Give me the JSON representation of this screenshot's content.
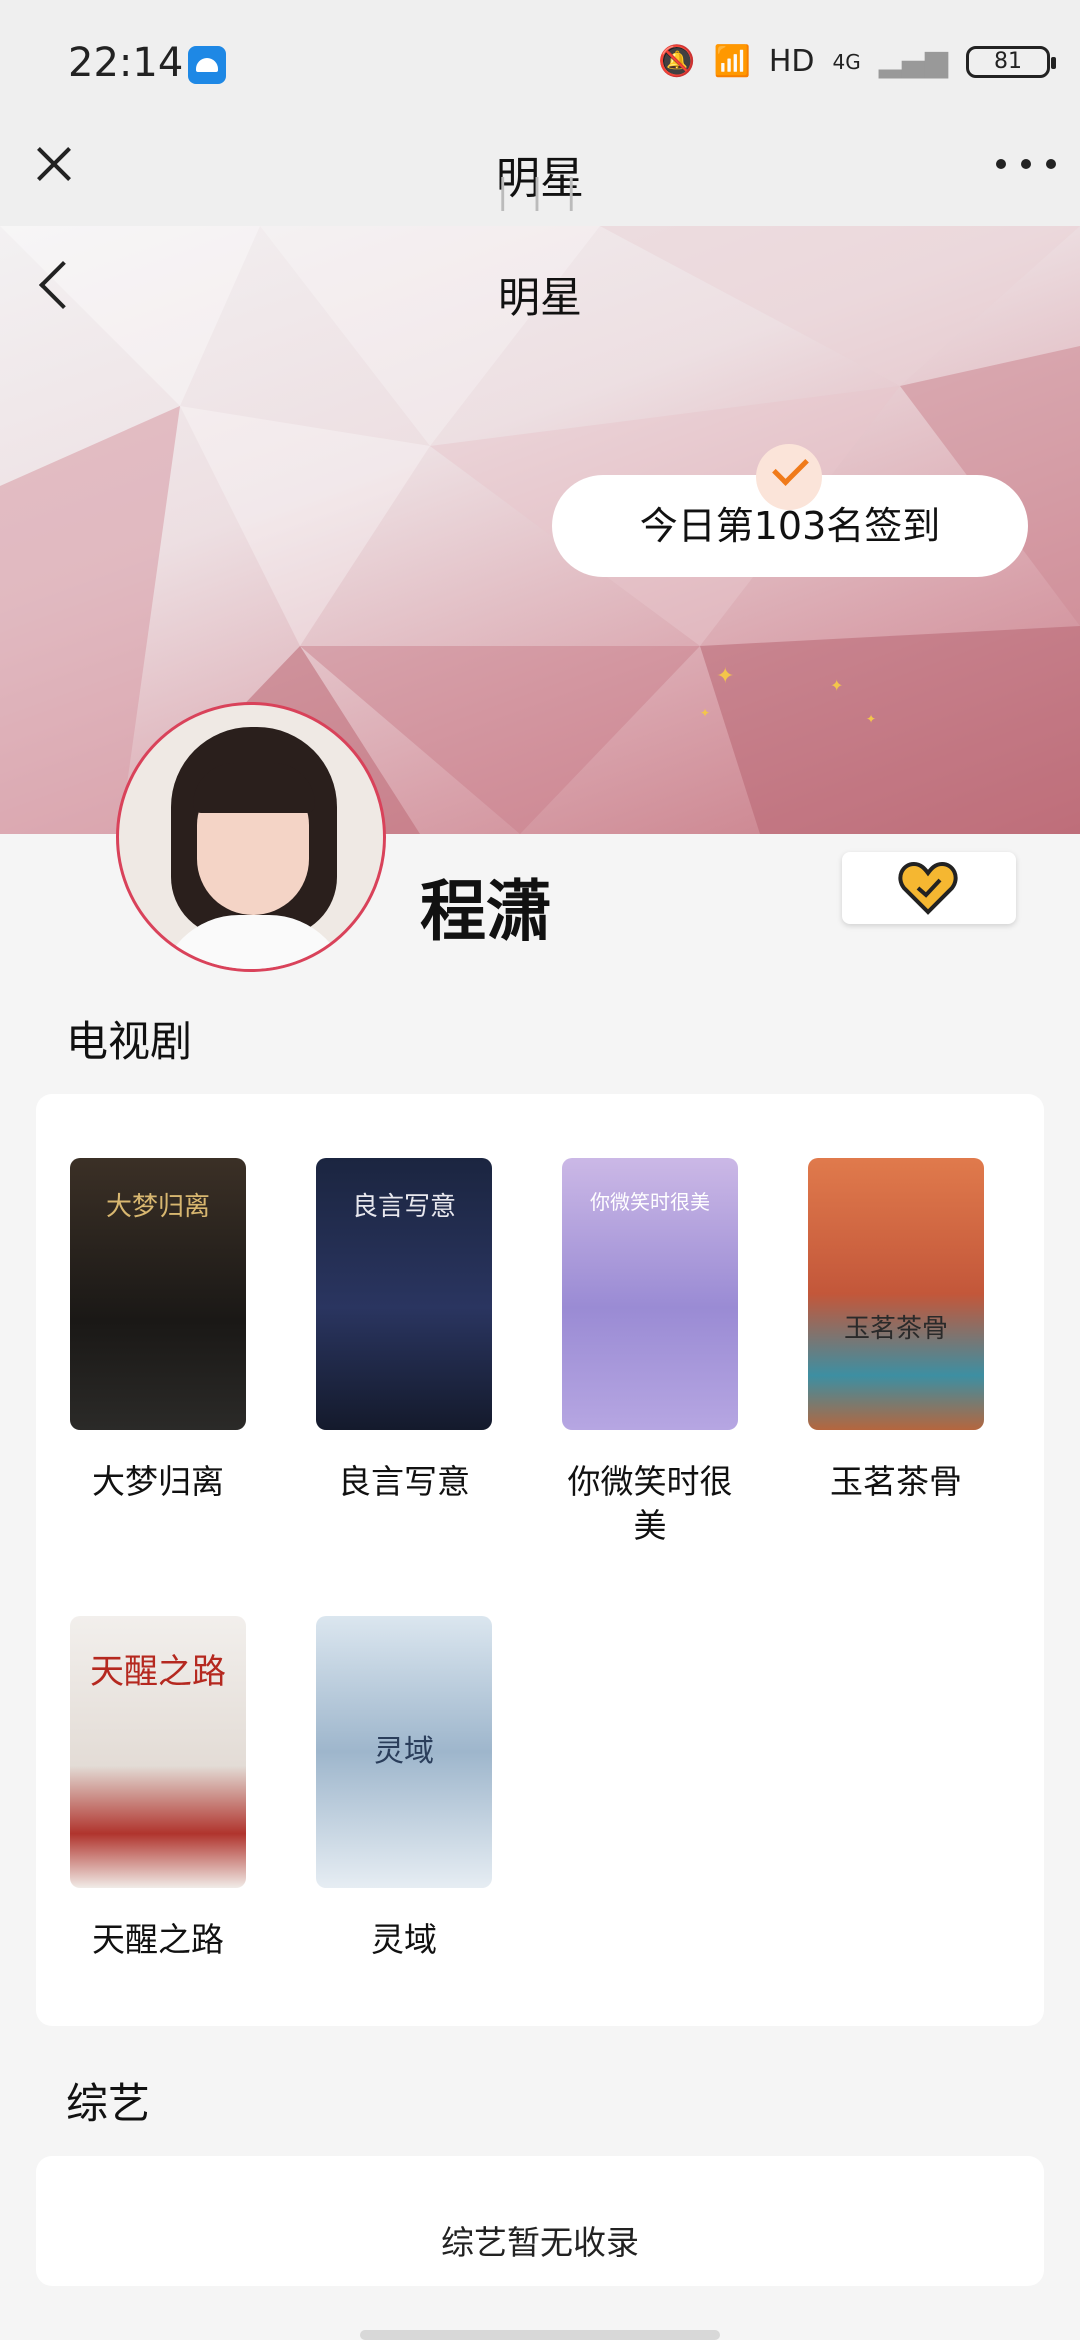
{
  "status_bar": {
    "time": "22:14",
    "network": "HD",
    "cell": "4G",
    "battery": "81"
  },
  "window": {
    "title": "明星",
    "subtitle": "| | |"
  },
  "hero": {
    "title": "明星",
    "checkin_text": "今日第103名签到"
  },
  "star": {
    "name": "程潇"
  },
  "sections": {
    "tv_title": "电视剧",
    "variety_title": "综艺",
    "variety_empty": "综艺暂无收录"
  },
  "dramas": [
    {
      "title": "大梦归离",
      "poster_text": "大梦归离"
    },
    {
      "title": "良言写意",
      "poster_text": "良言写意"
    },
    {
      "title": "你微笑时很美",
      "poster_text": "你微笑时很美"
    },
    {
      "title": "玉茗茶骨",
      "poster_text": "玉茗茶骨"
    },
    {
      "title": "天醒之路",
      "poster_text": "天醒之路"
    },
    {
      "title": "灵域",
      "poster_text": "灵域"
    }
  ],
  "colors": {
    "accent_orange": "#f07a1a",
    "avatar_ring": "#d9425a",
    "heart": "#f5b731"
  },
  "icons": [
    "close-icon",
    "more-icon",
    "back-icon",
    "check-icon",
    "heart-icon"
  ]
}
